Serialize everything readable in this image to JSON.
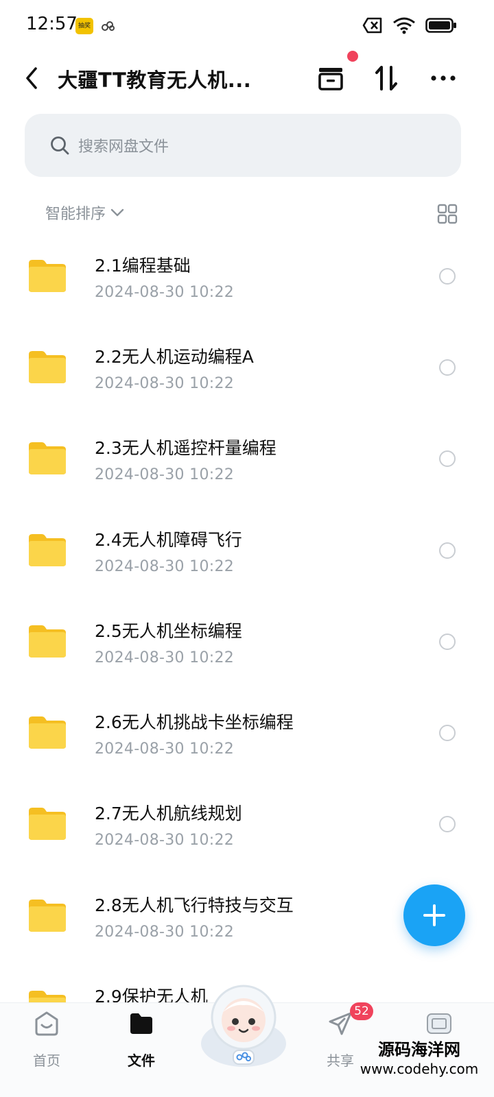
{
  "status_bar": {
    "time": "12:57",
    "badge_text": "抽奖"
  },
  "header": {
    "title": "大疆TT教育无人机..."
  },
  "search": {
    "placeholder": "搜索网盘文件"
  },
  "sort": {
    "label": "智能排序"
  },
  "files": [
    {
      "name": "2.1编程基础",
      "date": "2024-08-30  10:22"
    },
    {
      "name": "2.2无人机运动编程A",
      "date": "2024-08-30  10:22"
    },
    {
      "name": "2.3无人机遥控杆量编程",
      "date": "2024-08-30  10:22"
    },
    {
      "name": "2.4无人机障碍飞行",
      "date": "2024-08-30  10:22"
    },
    {
      "name": "2.5无人机坐标编程",
      "date": "2024-08-30  10:22"
    },
    {
      "name": "2.6无人机挑战卡坐标编程",
      "date": "2024-08-30  10:22"
    },
    {
      "name": "2.7无人机航线规划",
      "date": "2024-08-30  10:22"
    },
    {
      "name": "2.8无人机飞行特技与交互",
      "date": "2024-08-30  10:22"
    },
    {
      "name": "2.9保护无人机",
      "date": ""
    }
  ],
  "bottom_nav": {
    "home": "首页",
    "files": "文件",
    "share": "共享",
    "share_badge": "52"
  },
  "watermark": {
    "line1": "源码海洋网",
    "line2": "www.codehy.com"
  },
  "colors": {
    "accent": "#1aa3f5",
    "folder": "#f9cf3a",
    "badge": "#f0435c"
  }
}
